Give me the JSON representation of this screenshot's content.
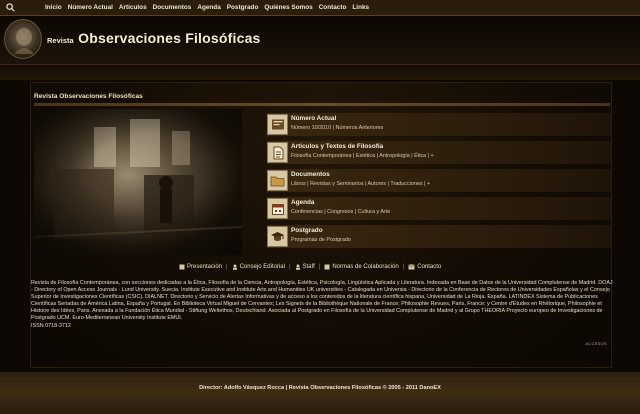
{
  "nav": {
    "search_icon": "search-icon",
    "items": [
      "Inicio",
      "Número Actual",
      "Artículos",
      "Documentos",
      "Agenda",
      "Postgrado",
      "Quiénes Somos",
      "Contacto",
      "Links"
    ]
  },
  "header": {
    "title_small": "Revista",
    "title_big": "Observaciones Filosóficas"
  },
  "section": {
    "title": "Revista Observaciones Filosóficas"
  },
  "menu": [
    {
      "title": "Número Actual",
      "subtitle": "Número 10/2010 | Números Anteriores",
      "icon": "book-icon"
    },
    {
      "title": "Artículos y Textos de Filosofía",
      "subtitle": "Filosofía Contemporánea | Estética | Antropología | Ética | +",
      "icon": "document-icon"
    },
    {
      "title": "Documentos",
      "subtitle": "Libros | Revistas y Seminarios | Autores | Traducciones | +",
      "icon": "folder-icon"
    },
    {
      "title": "Agenda",
      "subtitle": "Conferencias | Congresos | Cultura y Arte",
      "icon": "calendar-icon"
    },
    {
      "title": "Postgrado",
      "subtitle": "Programas de Postgrado",
      "icon": "graduation-cap-icon"
    }
  ],
  "links": [
    "Presentación",
    "Consejo Editorial",
    "Staff",
    "Normas de Colaboración",
    "Contacto"
  ],
  "description": "Revista de Filosofía Contemporánea, con secciones dedicadas a la Ética, Filosofía de la Ciencia, Antropología, Estética, Psicología, Lingüística Aplicada y Literatura. Indexada en Base de Datos de la Universidad Complutense de Madrid. DOAJ - Directory of Open Access Journals - Lund University. Suecia. Institute Executive and Institute Arts and Humanities UK universities - Catalogada en Universia - Directorio de la Conferencia de Rectores de Universidades Españolas y el Consejo Superior de Investigaciones Científicas (CSIC). DIALNET. Directorio y Servicio de Alertas Informativas y de acceso a los contenidos de la literatura científica hispana, Universidad de La Rioja. España. LATINDEX Sistema de Publicaciones Científicas Seriadas de América Latina, España y Portugal. En Biblioteca Virtual Miguel de Cervantes; Les Signets de la Bibliothèque Nationale de France; Philosophie Revues, Paris, France; y Centre d'Études en Rhétorique, Philosophie et Histoire des Idées, Paris. Anexada a la Fundación Ética Mundial - Stiftung Weltethos, Deutschland. Asociada al Postgrado en Filosofía de la Universidad Complutense de Madrid y al Grupo THEORIA Proyecto europeo de Investigaciones de Postgrado UCM. Euro-Mediterranean University Institute EMUI.",
  "issn": "ISSN 0718-3712",
  "counter": "ACCESOS",
  "footer": {
    "text": "Director: Adolfo Vásquez Rocca | Revista Observaciones Filosóficas © 2005 - 2011 DanoEX"
  }
}
